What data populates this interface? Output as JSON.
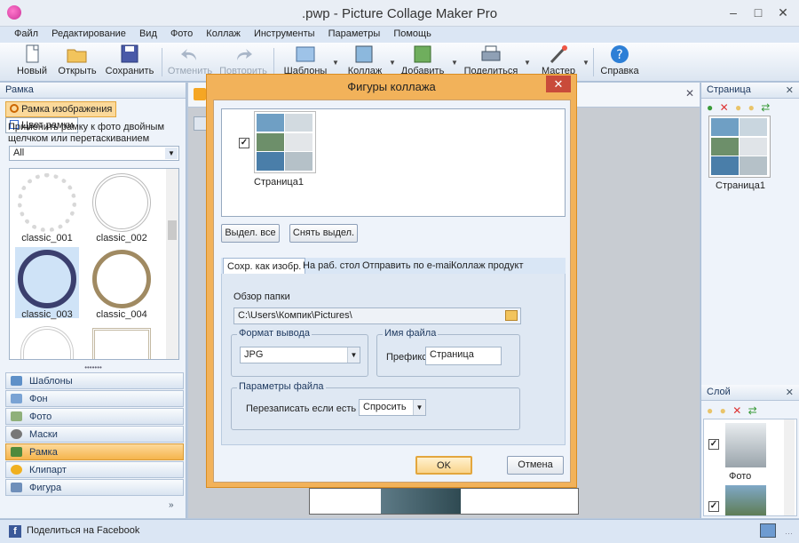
{
  "app": {
    "title": ".pwp - Picture Collage Maker Pro"
  },
  "menu": [
    "Файл",
    "Редактирование",
    "Вид",
    "Фото",
    "Коллаж",
    "Инструменты",
    "Параметры",
    "Помощь"
  ],
  "toolbar": {
    "new": "Новый",
    "open": "Открыть",
    "save": "Сохранить",
    "undo": "Отменить",
    "redo": "Повторить",
    "templates": "Шаблоны",
    "collage": "Коллаж",
    "add": "Добавить",
    "share": "Поделиться",
    "wizard": "Мастер",
    "help": "Справка"
  },
  "left_panel": {
    "title": "Рамка",
    "tab_image_frame": "Рамка изображения",
    "tab_frame_color": "Цвет рамки",
    "apply_text": "Применить рамку к фото двойным щелчком или перетаскиванием",
    "filter_value": "All",
    "frames": [
      "classic_001",
      "classic_002",
      "classic_003",
      "classic_004"
    ]
  },
  "nav": [
    "Шаблоны",
    "Фон",
    "Фото",
    "Маски",
    "Рамка",
    "Клипарт",
    "Фигура"
  ],
  "nav_selected": "Рамка",
  "right_panel": {
    "pages_title": "Страница",
    "page_label": "Страница1",
    "layers_title": "Слой",
    "layer_label": "Фото"
  },
  "status": {
    "facebook": "Поделиться на Facebook"
  },
  "dialog": {
    "title": "Фигуры коллажа",
    "page_label": "Страница1",
    "select_all": "Выдел. все",
    "deselect": "Снять выдел.",
    "tabs": [
      "Сохр. как изобр.",
      "На раб. стол",
      "Отправить по e-mail",
      "Коллаж продукт"
    ],
    "browse_label": "Обзор папки",
    "folder_path": "C:\\Users\\Компик\\Pictures\\",
    "output_format_label": "Формат вывода",
    "output_format": "JPG",
    "filename_label": "Имя файла",
    "prefix_label": "Префикс",
    "prefix_value": "Страница",
    "params_label": "Параметры файла",
    "overwrite_label": "Перезаписать если есть",
    "overwrite_value": "Спросить",
    "ok": "OK",
    "cancel": "Отмена"
  },
  "colors": {
    "accent": "#f2b25a",
    "selection": "#fbd99a",
    "ok_border": "#e3a63d"
  }
}
